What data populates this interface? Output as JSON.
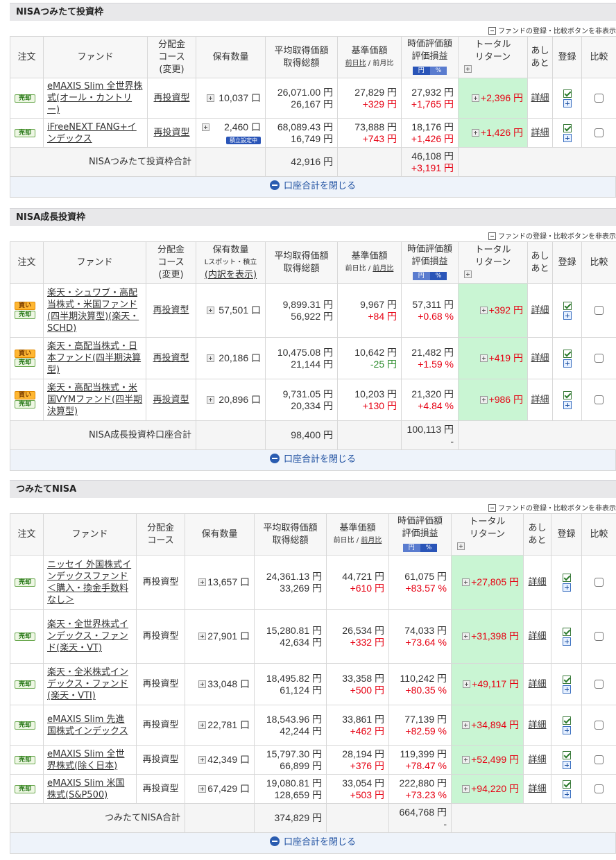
{
  "toggle_label": "ファンドの登録・比較ボタンを非表示",
  "close_label": "口座合計を閉じる",
  "unit_yen": "円",
  "unit_kuchi": "口",
  "sections": [
    {
      "title": "NISAつみたて投資枠",
      "headers": {
        "order": "注文",
        "fund": "ファンド",
        "dist": [
          "分配金",
          "コース",
          "(変更)"
        ],
        "qty": [
          "保有数量"
        ],
        "avg": [
          "平均取得価額",
          "取得総額"
        ],
        "base": [
          "基準価額",
          "前日比",
          "前月比"
        ],
        "value": [
          "時価評価額",
          "評価損益"
        ],
        "yen": "円",
        "pct": "%",
        "total": [
          "トータル",
          "リターン"
        ],
        "memo": [
          "あし",
          "あと"
        ],
        "reg": "登録",
        "cmp": "比較"
      },
      "rows": [
        {
          "badges": [
            "売却"
          ],
          "fund": "eMAXIS Slim 全世界株式(オール・カントリー)",
          "dist": "再投資型",
          "qty": "10,037 口",
          "avg": "26,071.00 円",
          "cost": "26,167 円",
          "base": "27,829 円",
          "day": "+329 円",
          "value": "27,932 円",
          "pl": "+1,765 円",
          "total": "+2,396 円",
          "detail": "詳細"
        },
        {
          "badges": [
            "売却"
          ],
          "fund": "iFreeNEXT FANG+インデックス",
          "dist": "再投資型",
          "qty": "2,460 口",
          "sub": "積立設定中",
          "avg": "68,089.43 円",
          "cost": "16,749 円",
          "base": "73,888 円",
          "day": "+743 円",
          "value": "18,176 円",
          "pl": "+1,426 円",
          "total": "+1,426 円",
          "detail": "詳細"
        }
      ],
      "sum": {
        "label": "NISAつみたて投資枠合計",
        "cost": "42,916 円",
        "value": "46,108 円",
        "pl": "+3,191 円"
      }
    },
    {
      "title": "NISA成長投資枠",
      "headers": {
        "order": "注文",
        "fund": "ファンド",
        "dist": [
          "分配金",
          "コース",
          "(変更)"
        ],
        "qty": [
          "保有数量",
          "Lスポット・積立",
          "(内訳を表示)"
        ],
        "avg": [
          "平均取得価額",
          "取得総額"
        ],
        "base": [
          "基準価額",
          "前日比",
          "前月比"
        ],
        "value": [
          "時価評価額",
          "評価損益"
        ],
        "yen": "円",
        "pct": "%",
        "total": [
          "トータル",
          "リターン"
        ],
        "memo": [
          "あし",
          "あと"
        ],
        "reg": "登録",
        "cmp": "比較"
      },
      "rows": [
        {
          "badges": [
            "買い",
            "売却"
          ],
          "fund": "楽天・シュワブ・高配当株式・米国ファンド(四半期決算型)(楽天・SCHD)",
          "dist": "再投資型",
          "qty": "57,501 口",
          "avg": "9,899.31 円",
          "cost": "56,922 円",
          "base": "9,967 円",
          "day": "+84 円",
          "value": "57,311 円",
          "pl": "+0.68 %",
          "total": "+392 円",
          "detail": "詳細"
        },
        {
          "badges": [
            "買い",
            "売却"
          ],
          "fund": "楽天・高配当株式・日本ファンド(四半期決算型)",
          "dist": "再投資型",
          "qty": "20,186 口",
          "avg": "10,475.08 円",
          "cost": "21,144 円",
          "base": "10,642 円",
          "day": "-25 円",
          "value": "21,482 円",
          "pl": "+1.59 %",
          "total": "+419 円",
          "detail": "詳細"
        },
        {
          "badges": [
            "買い",
            "売却"
          ],
          "fund": "楽天・高配当株式・米国VYMファンド(四半期決算型)",
          "dist": "再投資型",
          "qty": "20,896 口",
          "avg": "9,731.05 円",
          "cost": "20,334 円",
          "base": "10,203 円",
          "day": "+130 円",
          "value": "21,320 円",
          "pl": "+4.84 %",
          "total": "+986 円",
          "detail": "詳細"
        }
      ],
      "sum": {
        "label": "NISA成長投資枠口座合計",
        "cost": "98,400 円",
        "value": "100,113 円",
        "pl": "-"
      }
    },
    {
      "title": "つみたてNISA",
      "headers": {
        "order": "注文",
        "fund": "ファンド",
        "dist": [
          "分配金",
          "コース"
        ],
        "qty": [
          "保有数量"
        ],
        "avg": [
          "平均取得価額",
          "取得総額"
        ],
        "base": [
          "基準価額",
          "前日比",
          "前月比"
        ],
        "value": [
          "時価評価額",
          "評価損益"
        ],
        "yen": "円",
        "pct": "%",
        "total": [
          "トータル",
          "リターン"
        ],
        "memo": [
          "あし",
          "あと"
        ],
        "reg": "登録",
        "cmp": "比較"
      },
      "rows": [
        {
          "badges": [
            "売却"
          ],
          "fund": "ニッセイ 外国株式インデックスファンド＜購入・換金手数料なし＞",
          "dist": "再投資型",
          "qty": "13,657 口",
          "avg": "24,361.13 円",
          "cost": "33,269 円",
          "base": "44,721 円",
          "day": "+610 円",
          "value": "61,075 円",
          "pl": "+83.57 %",
          "total": "+27,805 円",
          "detail": "詳細"
        },
        {
          "badges": [
            "売却"
          ],
          "fund": "楽天・全世界株式インデックス・ファンド(楽天・VT)",
          "dist": "再投資型",
          "qty": "27,901 口",
          "avg": "15,280.81 円",
          "cost": "42,634 円",
          "base": "26,534 円",
          "day": "+332 円",
          "value": "74,033 円",
          "pl": "+73.64 %",
          "total": "+31,398 円",
          "detail": "詳細"
        },
        {
          "badges": [
            "売却"
          ],
          "fund": "楽天・全米株式インデックス・ファンド(楽天・VTI)",
          "dist": "再投資型",
          "qty": "33,048 口",
          "avg": "18,495.82 円",
          "cost": "61,124 円",
          "base": "33,358 円",
          "day": "+500 円",
          "value": "110,242 円",
          "pl": "+80.35 %",
          "total": "+49,117 円",
          "detail": "詳細"
        },
        {
          "badges": [
            "売却"
          ],
          "fund": "eMAXIS Slim 先進国株式インデックス",
          "dist": "再投資型",
          "qty": "22,781 口",
          "avg": "18,543.96 円",
          "cost": "42,244 円",
          "base": "33,861 円",
          "day": "+462 円",
          "value": "77,139 円",
          "pl": "+82.59 %",
          "total": "+34,894 円",
          "detail": "詳細"
        },
        {
          "badges": [
            "売却"
          ],
          "fund": "eMAXIS Slim 全世界株式(除く日本)",
          "dist": "再投資型",
          "qty": "42,349 口",
          "avg": "15,797.30 円",
          "cost": "66,899 円",
          "base": "28,194 円",
          "day": "+376 円",
          "value": "119,399 円",
          "pl": "+78.47 %",
          "total": "+52,499 円",
          "detail": "詳細"
        },
        {
          "badges": [
            "売却"
          ],
          "fund": "eMAXIS Slim 米国株式(S&P500)",
          "dist": "再投資型",
          "qty": "67,429 口",
          "avg": "19,080.81 円",
          "cost": "128,659 円",
          "base": "33,054 円",
          "day": "+503 円",
          "value": "222,880 円",
          "pl": "+73.23 %",
          "total": "+94,220 円",
          "detail": "詳細"
        }
      ],
      "sum": {
        "label": "つみたてNISA合計",
        "cost": "374,829 円",
        "value": "664,768 円",
        "pl": "-"
      }
    }
  ]
}
